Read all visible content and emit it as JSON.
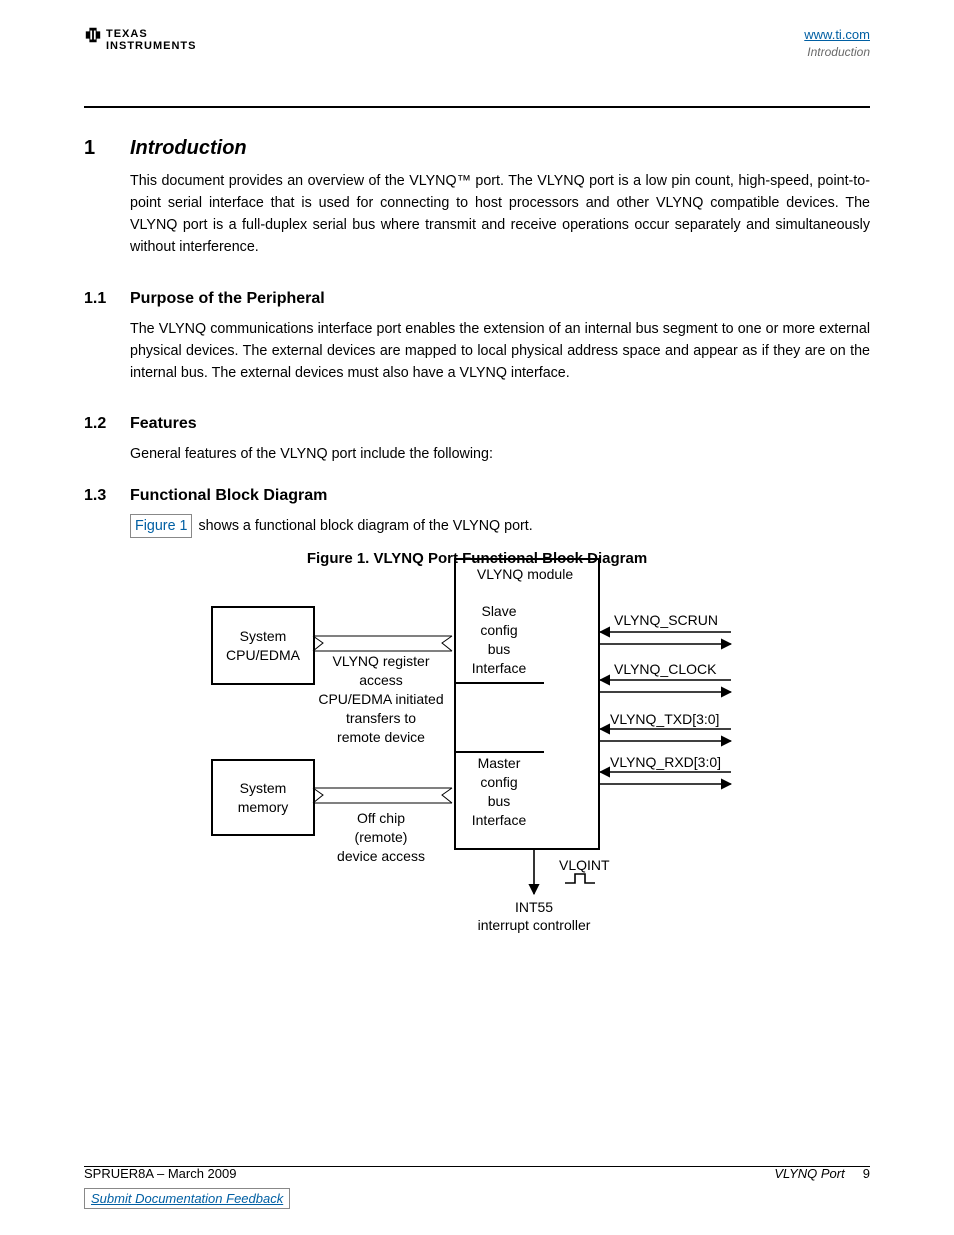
{
  "header": {
    "logo_top": "TEXAS",
    "logo_bottom": "INSTRUMENTS",
    "right_link": "www.ti.com",
    "right_italic": "Introduction"
  },
  "section1": {
    "num": "1",
    "title": "Introduction",
    "para": "This document provides an overview of the VLYNQ™ port. The VLYNQ port is a low pin count, high-speed, point-to-point serial interface that is used for connecting to host processors and other VLYNQ compatible devices. The VLYNQ port is a full-duplex serial bus where transmit and receive operations occur separately and simultaneously without interference."
  },
  "section1_1": {
    "num": "1.1",
    "title": "Purpose of the Peripheral",
    "para": "The VLYNQ communications interface port enables the extension of an internal bus segment to one or more external physical devices. The external devices are mapped to local physical address space and appear as if they are on the internal bus. The external devices must also have a VLYNQ interface."
  },
  "section1_2": {
    "num": "1.2",
    "title": "Features",
    "para": "General features of the VLYNQ port include the following:"
  },
  "section1_3": {
    "num": "1.3",
    "title": "Functional Block Diagram",
    "link_text": "Figure 1",
    "after_link": "shows a functional block diagram of the VLYNQ port."
  },
  "figure": {
    "caption": "Figure 1. VLYNQ Port Functional Block Diagram"
  },
  "diagram": {
    "module_title": "VLYNQ module",
    "sys_cpu": "System\nCPU/EDMA",
    "sys_mem": "System\nmemory",
    "slave": "Slave\nconfig\nbus\nInterface",
    "master": "Master\nconfig\nbus\nInterface",
    "mid_upper": "VLYNQ register\naccess\nCPU/EDMA initiated\ntransfers to\nremote device",
    "mid_lower": "Off chip\n(remote)\ndevice access",
    "signals": {
      "scrun": "VLYNQ_SCRUN",
      "clock": "VLYNQ_CLOCK",
      "txd": "VLYNQ_TXD[3:0]",
      "rxd": "VLYNQ_RXD[3:0]"
    },
    "vlqint": "VLQINT",
    "int55_a": "INT55",
    "int55_b": "interrupt controller"
  },
  "footer": {
    "left": "SPRUER8A – March 2009",
    "right_italic": "VLYNQ Port",
    "right_page": "9",
    "feedback_pre": "Submit Documentation Feedback"
  }
}
